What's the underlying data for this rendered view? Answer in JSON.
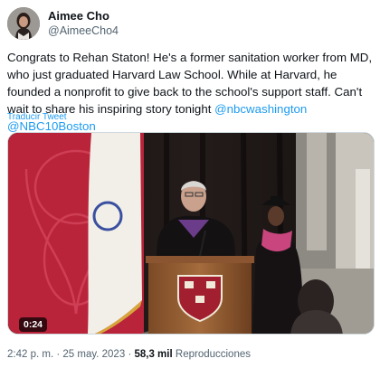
{
  "author": {
    "name": "Aimee Cho",
    "handle": "@AimeeCho4"
  },
  "tweet": {
    "text_before": "Congrats to Rehan Staton! He's a former sanitation worker from MD, who just graduated Harvard Law School. While at Harvard, he founded a nonprofit to give back to the school's support staff. Can't wait to share his inspiring story tonight ",
    "mention_1": "@nbcwashington",
    "mention_2": "@NBC10Boston",
    "translate_label": "Traducir Tweet"
  },
  "media": {
    "duration": "0:24"
  },
  "meta": {
    "time": "2:42 p. m.",
    "separator_1": "·",
    "date": "25 may. 2023",
    "separator_2": "·",
    "views_count": "58,3 mil",
    "views_label": "Reproducciones"
  },
  "colors": {
    "link": "#1d9bf0",
    "secondary_text": "#536471"
  }
}
